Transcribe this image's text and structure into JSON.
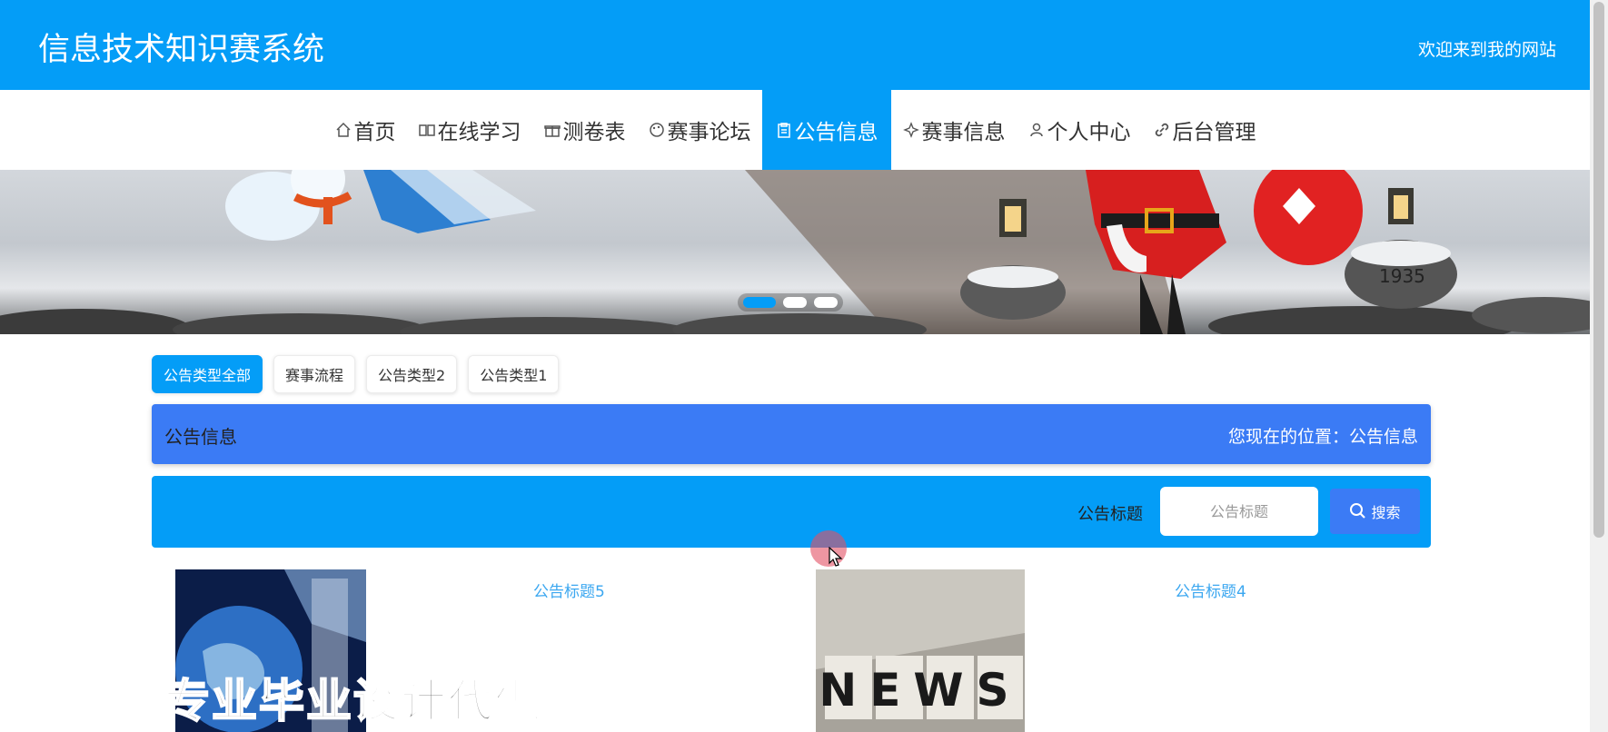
{
  "header": {
    "title": "信息技术知识赛系统",
    "welcome": "欢迎来到我的网站"
  },
  "nav": {
    "items": [
      {
        "label": "首页",
        "icon": "home-icon"
      },
      {
        "label": "在线学习",
        "icon": "book-icon"
      },
      {
        "label": "测卷表",
        "icon": "gift-icon"
      },
      {
        "label": "赛事论坛",
        "icon": "palette-icon"
      },
      {
        "label": "公告信息",
        "icon": "clipboard-icon"
      },
      {
        "label": "赛事信息",
        "icon": "spark-icon"
      },
      {
        "label": "个人中心",
        "icon": "user-icon"
      },
      {
        "label": "后台管理",
        "icon": "link-icon"
      }
    ],
    "active_item": "公告信息"
  },
  "banner": {
    "slides": 3,
    "active_slide": 1,
    "badge_text": "1935"
  },
  "type_tabs": [
    "公告类型全部",
    "赛事流程",
    "公告类型2",
    "公告类型1"
  ],
  "location": {
    "title": "公告信息",
    "breadcrumb": "您现在的位置：公告信息"
  },
  "search": {
    "label": "公告标题",
    "placeholder": "公告标题",
    "button_label": "搜索"
  },
  "notices": [
    {
      "title": "公告标题5"
    },
    {
      "title": "公告标题4",
      "image_text": "NEWS"
    }
  ],
  "watermark": "专业毕业设计代做",
  "colors": {
    "primary": "#049DF7",
    "accent": "#3B7BF5",
    "link": "#3BA7F0"
  }
}
